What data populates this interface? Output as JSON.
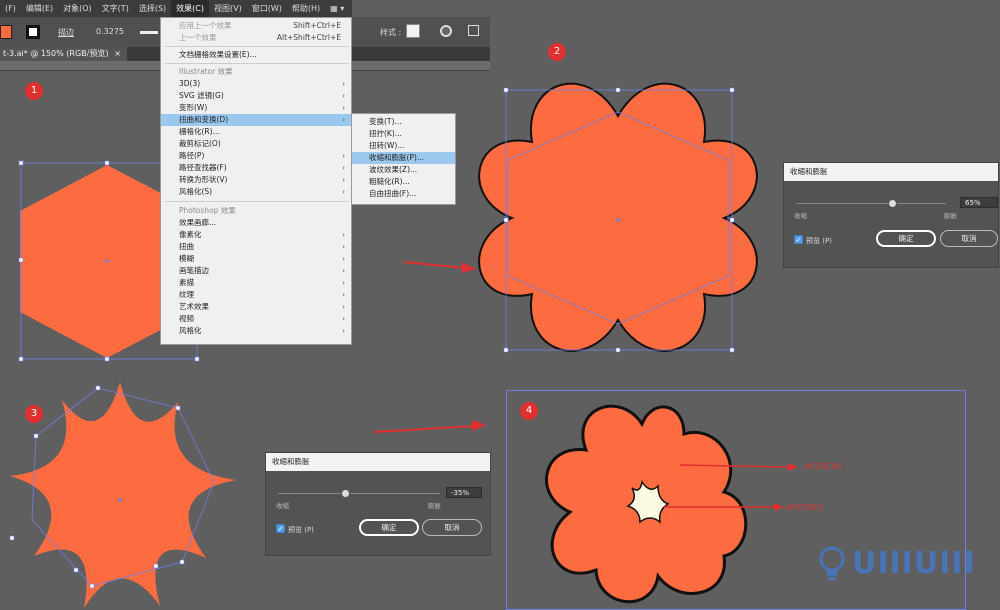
{
  "menubar": {
    "items": [
      "(F)",
      "编辑(E)",
      "对象(O)",
      "文字(T)",
      "选择(S)",
      "效果(C)",
      "视图(V)",
      "窗口(W)",
      "帮助(H)",
      "▦ ▾"
    ],
    "active_index": 5
  },
  "control_bar": {
    "stroke_label": "描边",
    "stroke_value": "0.3275",
    "style_label": "样式 :"
  },
  "document_tab": {
    "label": "t-3.ai* @ 150% (RGB/预览)",
    "close": "×"
  },
  "effect_menu": {
    "apply_last": "应用上一个效果",
    "apply_last_shortcut": "Shift+Ctrl+E",
    "last_effect": "上一个效果",
    "last_effect_shortcut": "Alt+Shift+Ctrl+E",
    "doc_raster_settings": "文档栅格效果设置(E)...",
    "illustrator_section": "Illustrator 效果",
    "illustrator_items": [
      "3D(3)",
      "SVG 滤镜(G)",
      "变形(W)",
      "扭曲和变换(D)",
      "栅格化(R)...",
      "裁剪标记(O)",
      "路径(P)",
      "路径查找器(F)",
      "转换为形状(V)",
      "风格化(S)"
    ],
    "photoshop_section": "Photoshop 效果",
    "photoshop_items": [
      "效果画廊...",
      "像素化",
      "扭曲",
      "模糊",
      "画笔描边",
      "素描",
      "纹理",
      "艺术效果",
      "视频",
      "风格化"
    ]
  },
  "distort_submenu": {
    "items": [
      "变换(T)...",
      "扭拧(K)...",
      "扭转(W)...",
      "收缩和膨胀(P)...",
      "波纹效果(Z)...",
      "粗糙化(R)...",
      "自由扭曲(F)..."
    ],
    "highlight_index": 3
  },
  "badges": [
    "1",
    "2",
    "3",
    "4"
  ],
  "dialog_right": {
    "title": "收缩和膨胀",
    "left_label": "收缩",
    "right_label": "膨胀",
    "value": "65%",
    "preview_label": "预览 (P)",
    "ok": "确定",
    "cancel": "取消"
  },
  "dialog_bottom": {
    "title": "收缩和膨胀",
    "left_label": "收缩",
    "right_label": "膨胀",
    "value": "-35%",
    "preview_label": "预览 (P)",
    "ok": "确定",
    "cancel": "取消"
  },
  "annotations": {
    "color_outer": "#FC6C40",
    "color_inner": "#FCFAE3"
  },
  "watermark": {
    "text": "UIIIUIII"
  },
  "colors": {
    "shape_orange": "#fc6c40",
    "center_cream": "#fcfae3",
    "selection_blue": "#6f7fe6",
    "arrow_red": "#e22f2f"
  }
}
